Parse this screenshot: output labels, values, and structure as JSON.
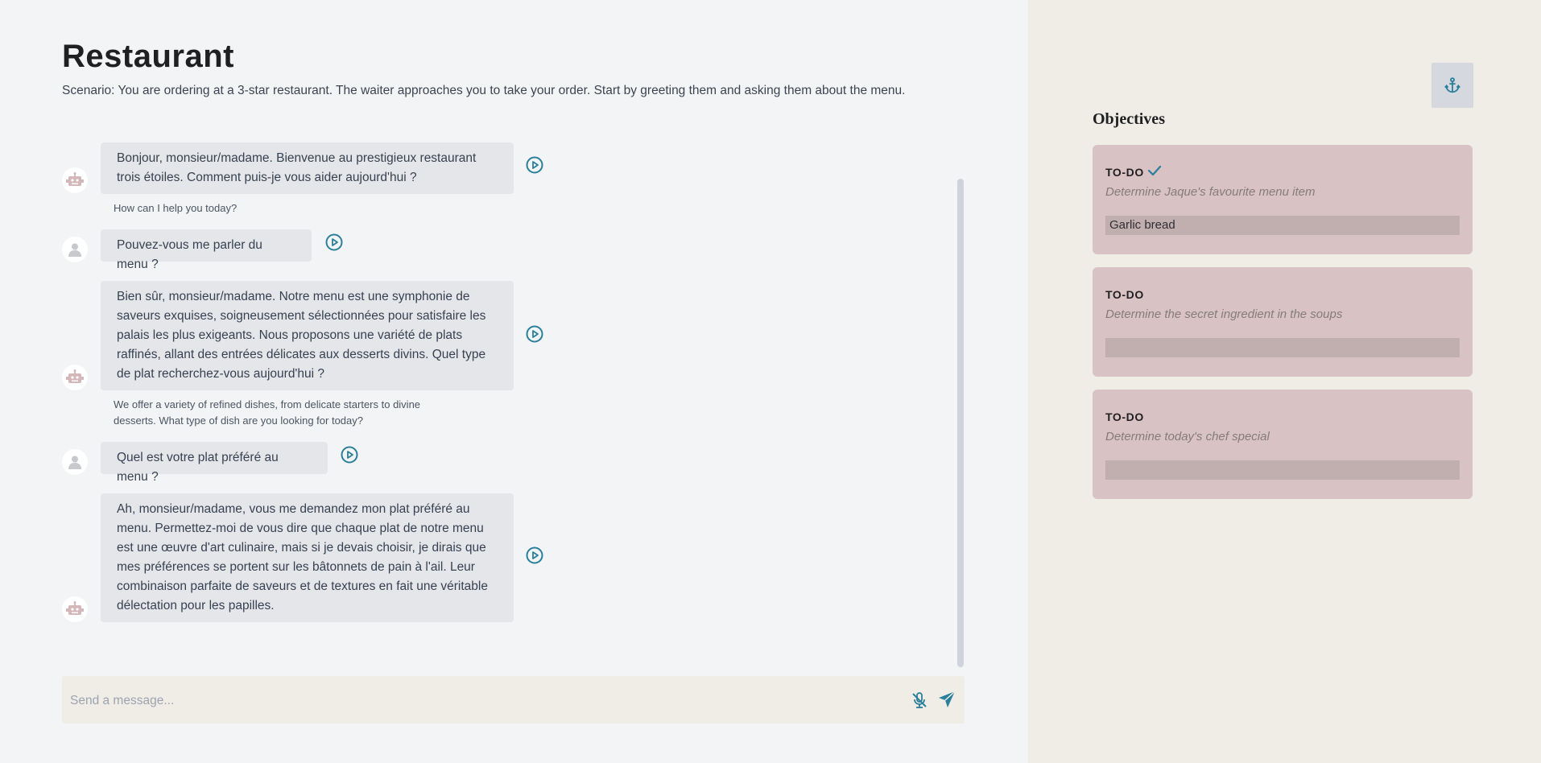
{
  "header": {
    "title": "Restaurant",
    "scenario": "Scenario: You are ordering at a 3-star restaurant. The waiter approaches you to take your order. Start by greeting them and asking them about the menu."
  },
  "conversation": [
    {
      "role": "bot",
      "text": "Bonjour, monsieur/madame. Bienvenue au prestigieux restaurant trois étoiles. Comment puis-je vous aider aujourd'hui ?",
      "translation": "How can I help you today?"
    },
    {
      "role": "user",
      "text": "Pouvez-vous me parler du menu ?"
    },
    {
      "role": "bot",
      "text": "Bien sûr, monsieur/madame. Notre menu est une symphonie de saveurs exquises, soigneusement sélectionnées pour satisfaire les palais les plus exigeants. Nous proposons une variété de plats raffinés, allant des entrées délicates aux desserts divins. Quel type de plat recherchez-vous aujourd'hui ?",
      "translation": "We offer a variety of refined dishes, from delicate starters to divine desserts. What type of dish are you looking for today?"
    },
    {
      "role": "user",
      "text": "Quel est votre plat préféré au menu ?"
    },
    {
      "role": "bot",
      "text": "Ah, monsieur/madame, vous me demandez mon plat préféré au menu. Permettez-moi de vous dire que chaque plat de notre menu est une œuvre d'art culinaire, mais si je devais choisir, je dirais que mes préférences se portent sur les bâtonnets de pain à l'ail. Leur combinaison parfaite de saveurs et de textures en fait une véritable délectation pour les papilles."
    }
  ],
  "input": {
    "placeholder": "Send a message...",
    "value": ""
  },
  "objectives": {
    "title": "Objectives",
    "items": [
      {
        "status": "TO-DO",
        "completed": true,
        "description": "Determine Jaque's favourite menu item",
        "answer": "Garlic bread"
      },
      {
        "status": "TO-DO",
        "completed": false,
        "description": "Determine the secret ingredient in the soups",
        "answer": ""
      },
      {
        "status": "TO-DO",
        "completed": false,
        "description": "Determine today's chef special",
        "answer": ""
      }
    ]
  },
  "icons": {
    "bot_avatar": "robot-icon",
    "user_avatar": "user-icon",
    "play": "play-circle-icon",
    "mic_off": "microphone-off-icon",
    "send": "send-icon",
    "anchor": "anchor-icon",
    "check": "check-icon"
  },
  "colors": {
    "accent": "#2a7f9a",
    "sidebar_bg": "#f0ede7",
    "objective_card_bg": "#d8c2c4",
    "bubble_bg": "#e5e6e9"
  }
}
